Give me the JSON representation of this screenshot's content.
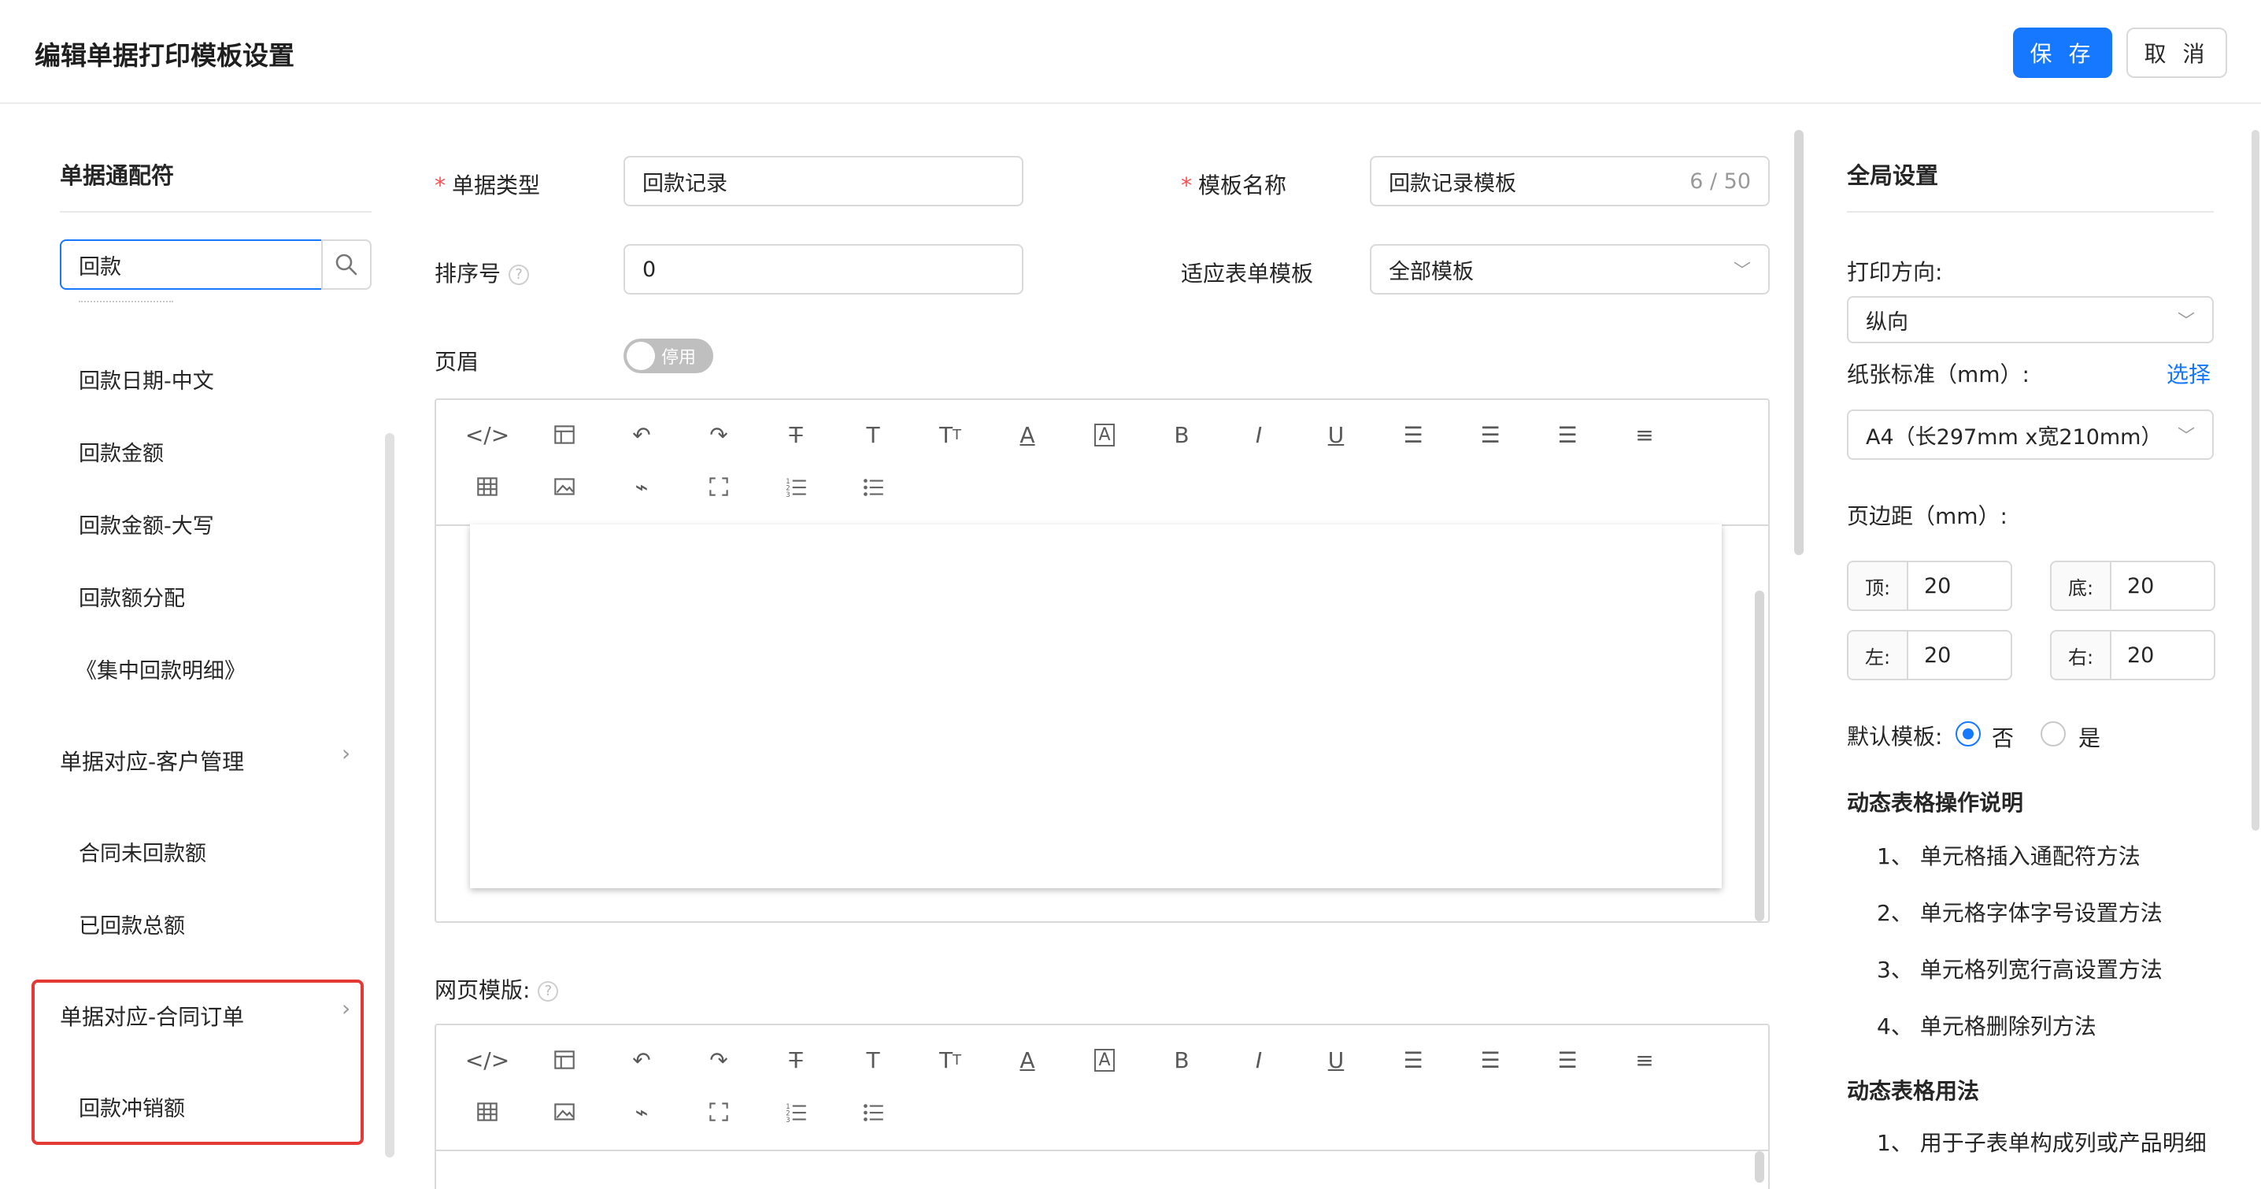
{
  "header": {
    "title": "编辑单据打印模板设置",
    "save_label": "保 存",
    "cancel_label": "取 消"
  },
  "left_panel": {
    "title": "单据通配符",
    "search_value": "回款",
    "items_top": [
      "回款日期-中文",
      "回款金额",
      "回款金额-大写",
      "回款额分配",
      "《集中回款明细》"
    ],
    "group_customer": "单据对应-客户管理",
    "items_customer": [
      "合同未回款额",
      "已回款总额"
    ],
    "group_contract": "单据对应-合同订单",
    "items_contract": [
      "回款冲销额"
    ]
  },
  "form": {
    "doc_type_label": "单据类型",
    "doc_type_value": "回款记录",
    "template_name_label": "模板名称",
    "template_name_value": "回款记录模板",
    "template_name_counter": "6 / 50",
    "sort_label": "排序号",
    "sort_value": "0",
    "apply_label": "适应表单模板",
    "apply_value": "全部模板",
    "header_label": "页眉",
    "header_toggle": "停用",
    "web_template_label": "网页模版:"
  },
  "right_panel": {
    "title": "全局设置",
    "orientation_label": "打印方向:",
    "orientation_value": "纵向",
    "paper_label": "纸张标准（mm）:",
    "paper_select_link": "选择",
    "paper_value": "A4（长297mm x宽210mm）",
    "margin_label": "页边距（mm）:",
    "margin_top_label": "顶:",
    "margin_top": "20",
    "margin_bottom_label": "底:",
    "margin_bottom": "20",
    "margin_left_label": "左:",
    "margin_left": "20",
    "margin_right_label": "右:",
    "margin_right": "20",
    "default_label": "默认模板:",
    "default_no": "否",
    "default_yes": "是",
    "default_selected": "否",
    "dyn_ops_title": "动态表格操作说明",
    "dyn_ops": [
      "1、 单元格插入通配符方法",
      "2、 单元格字体字号设置方法",
      "3、 单元格列宽行高设置方法",
      "4、 单元格删除列方法"
    ],
    "dyn_usage_title": "动态表格用法",
    "dyn_usage": [
      "1、 用于子表单构成列或产品明细"
    ]
  },
  "colors": {
    "primary": "#1677ff",
    "required": "#ff4d4f",
    "highlight_box": "#e53935"
  }
}
